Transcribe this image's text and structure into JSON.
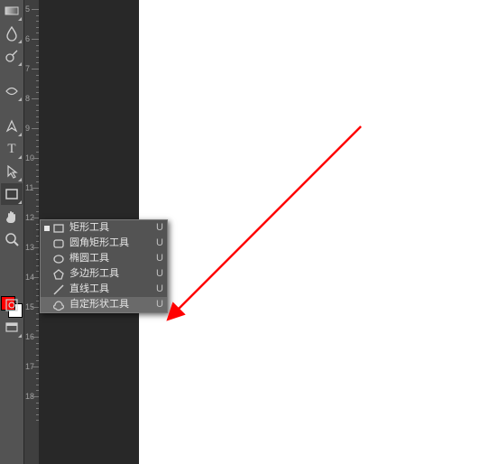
{
  "ruler": {
    "labels": [
      "5",
      "6",
      "7",
      "8",
      "9",
      "10",
      "11",
      "12",
      "13",
      "14",
      "15",
      "16",
      "17",
      "18"
    ]
  },
  "tools": [
    {
      "id": "blur-tool",
      "flyout": true
    },
    {
      "id": "dodge-tool",
      "flyout": true
    },
    {
      "id": "pen-tool",
      "flyout": true
    },
    {
      "id": "type-tool",
      "label": "T",
      "flyout": true
    },
    {
      "id": "path-select-tool",
      "flyout": true
    },
    {
      "id": "shape-tool",
      "flyout": true,
      "selected": true
    },
    {
      "id": "hand-tool",
      "flyout": false
    },
    {
      "id": "zoom-tool",
      "flyout": false
    }
  ],
  "lower_icons": [
    {
      "id": "quickmask-icon"
    },
    {
      "id": "screenmode-icon"
    }
  ],
  "swatches": {
    "fg": "#ff0000",
    "bg": "#ffffff"
  },
  "flyout": {
    "items": [
      {
        "icon": "rect",
        "label": "矩形工具",
        "key": "U",
        "current": true
      },
      {
        "icon": "roundrect",
        "label": "圆角矩形工具",
        "key": "U"
      },
      {
        "icon": "ellipse",
        "label": "椭圆工具",
        "key": "U"
      },
      {
        "icon": "polygon",
        "label": "多边形工具",
        "key": "U"
      },
      {
        "icon": "line",
        "label": "直线工具",
        "key": "U"
      },
      {
        "icon": "custom",
        "label": "自定形状工具",
        "key": "U",
        "selected": true
      }
    ]
  },
  "annotation": {
    "stroke": "#ff0000"
  }
}
